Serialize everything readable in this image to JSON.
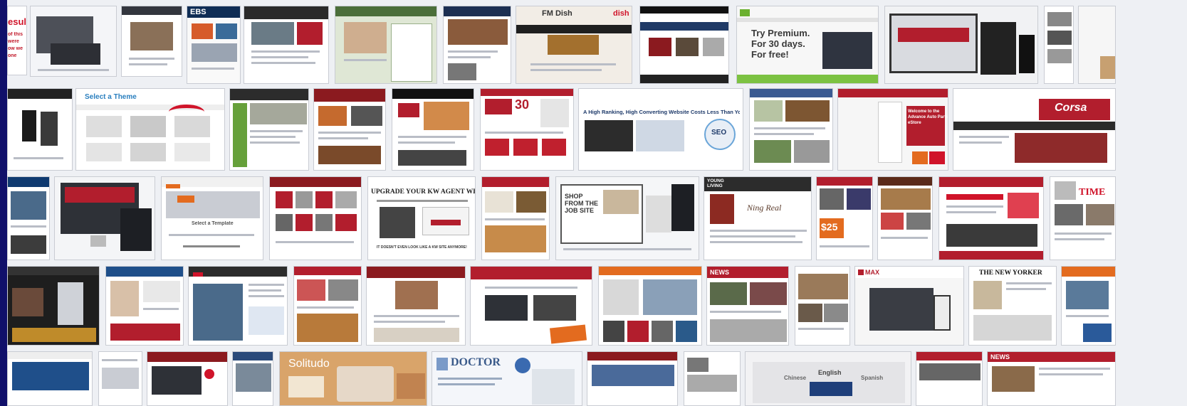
{
  "gallery": {
    "captions": {
      "results_fragment": "esults",
      "results_lines": [
        "of this",
        "were",
        "ow we",
        "one"
      ],
      "fm_dish": "FM Dish",
      "dish": "dish",
      "try_premium": "Try Premium.\nFor 30 days.\nFor free!",
      "select_a_theme": "Select a Theme",
      "high_ranking": "A High Ranking, High Converting Website Costs Less Than You Think!",
      "seo": "SEO",
      "corsa": "Corsa",
      "welcome": "Welcome to the\nAdvance Auto Parts\neStore",
      "upgrade_kw": "UPGRADE YOUR KW AGENT WEBSITE!",
      "upgrade_kw_tagline": "IT DOESN'T EVEN LOOK LIKE A KW SITE ANYMORE!",
      "select_a_template": "Select a Template",
      "shop_job": "SHOP\nFROM THE\nJOB SITE",
      "young_living": "YOUNG\nLIVING",
      "ning_script": "Ning Real",
      "time": "TIME",
      "new_yorker": "THE NEW YORKER",
      "max": "MAX",
      "solitudo": "Solitudo",
      "doctor": "DOCTOR",
      "english": "English",
      "chinese": "Chinese",
      "spanish": "Spanish",
      "ebs": "EBS",
      "news": "NEWS",
      "price_30": "30",
      "price_25": "$25"
    }
  }
}
